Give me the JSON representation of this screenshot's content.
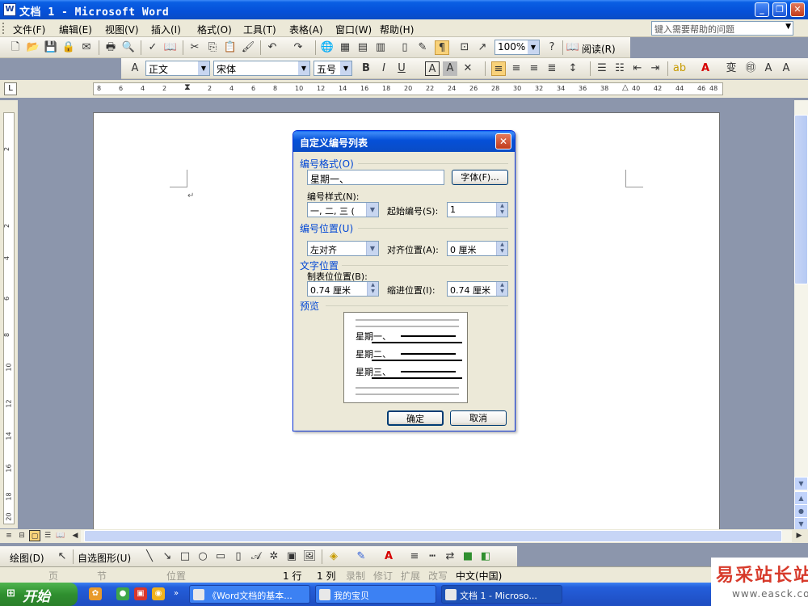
{
  "window": {
    "title": "文档 1 - Microsoft Word",
    "app_icon": "W",
    "controls": {
      "minimize": "_",
      "restore": "❐",
      "close": "✕"
    }
  },
  "menubar": {
    "items": [
      "文件(F)",
      "编辑(E)",
      "视图(V)",
      "插入(I)",
      "格式(O)",
      "工具(T)",
      "表格(A)",
      "窗口(W)",
      "帮助(H)"
    ],
    "help_placeholder": "键入需要帮助的问题"
  },
  "toolbar_standard": {
    "zoom": "100%",
    "read_label": "阅读(R)"
  },
  "toolbar_formatting": {
    "style": "正文",
    "font": "宋体",
    "size": "五号"
  },
  "ruler": {
    "h_ticks": [
      "8",
      "6",
      "4",
      "2",
      "2",
      "4",
      "6",
      "8",
      "10",
      "12",
      "14",
      "16",
      "18",
      "20",
      "22",
      "24",
      "26",
      "28",
      "30",
      "32",
      "34",
      "36",
      "38",
      "40",
      "42",
      "44",
      "46",
      "48"
    ],
    "v_ticks": [
      "2",
      "2",
      "4",
      "6",
      "8",
      "10",
      "12",
      "14",
      "16",
      "18",
      "20"
    ]
  },
  "dialog": {
    "title": "自定义编号列表",
    "close": "✕",
    "number_format_group": "编号格式(O)",
    "number_format_value": "星期一、",
    "font_button": "字体(F)...",
    "number_style_label": "编号样式(N):",
    "number_style_value": "一, 二, 三 (",
    "start_at_label": "起始编号(S):",
    "start_at_value": "1",
    "number_position_group": "编号位置(U)",
    "alignment_value": "左对齐",
    "aligned_at_label": "对齐位置(A):",
    "aligned_at_value": "0 厘米",
    "text_position_group": "文字位置",
    "tab_space_label": "制表位位置(B):",
    "tab_space_value": "0.74 厘米",
    "indent_at_label": "缩进位置(I):",
    "indent_at_value": "0.74 厘米",
    "preview_group": "预览",
    "preview_items": [
      "星期一、",
      "星期二、",
      "星期三、"
    ],
    "ok": "确定",
    "cancel": "取消"
  },
  "drawing_toolbar": {
    "draw_label": "绘图(D)",
    "autoshapes_label": "自选图形(U)"
  },
  "statusbar": {
    "page": "页",
    "section": "节",
    "position": "位置",
    "line": "1 行",
    "column": "1 列",
    "rec": "录制",
    "trk": "修订",
    "ext": "扩展",
    "ovr": "改写",
    "lang": "中文(中国)"
  },
  "taskbar": {
    "start": "开始",
    "tasks": [
      "《Word文档的基本...",
      "我的宝贝",
      "文档 1 - Microso..."
    ],
    "more": "»"
  },
  "watermark": {
    "name": "易采站长站",
    "url": "www.easck.com"
  },
  "colors": {
    "title_blue": "#0a4cc4",
    "dialog_group_blue": "#0046d5",
    "taskbar_green": "#2f8f2f",
    "watermark_red": "#d73a2b"
  }
}
